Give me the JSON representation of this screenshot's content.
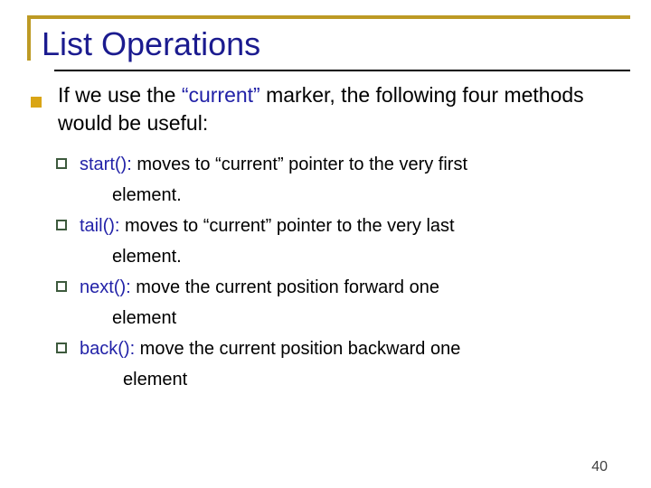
{
  "slide": {
    "title": "List Operations",
    "page_number": "40",
    "accent_gold": "#bd9a24",
    "title_color": "#1b1b8f",
    "keyword_color": "#2222a8",
    "bullet_fill": "#d9a515",
    "subbullet_outline": "#3d5a3d"
  },
  "body": {
    "lead": {
      "before": "If we use the ",
      "keyword": "“current”",
      "after": " marker, the following four methods would be useful:"
    },
    "methods": [
      {
        "name": "start():",
        "description": " moves to “current” pointer to the very first",
        "continuation": "element.",
        "indent": "normal"
      },
      {
        "name": "tail():",
        "description": " moves to “current” pointer to the very last",
        "continuation": "element.",
        "indent": "normal"
      },
      {
        "name": "next():",
        "description": " move the current position forward one",
        "continuation": "element",
        "indent": "normal"
      },
      {
        "name": "back():",
        "description": " move the current position backward one",
        "continuation": "element",
        "indent": "deep"
      }
    ]
  }
}
